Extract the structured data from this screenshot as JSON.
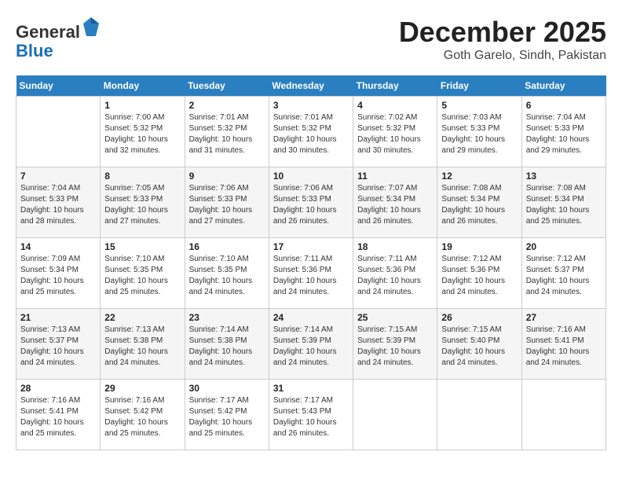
{
  "header": {
    "logo_general": "General",
    "logo_blue": "Blue",
    "month_title": "December 2025",
    "subtitle": "Goth Garelo, Sindh, Pakistan"
  },
  "calendar": {
    "weekdays": [
      "Sunday",
      "Monday",
      "Tuesday",
      "Wednesday",
      "Thursday",
      "Friday",
      "Saturday"
    ],
    "weeks": [
      [
        {
          "day": "",
          "info": ""
        },
        {
          "day": "1",
          "info": "Sunrise: 7:00 AM\nSunset: 5:32 PM\nDaylight: 10 hours\nand 32 minutes."
        },
        {
          "day": "2",
          "info": "Sunrise: 7:01 AM\nSunset: 5:32 PM\nDaylight: 10 hours\nand 31 minutes."
        },
        {
          "day": "3",
          "info": "Sunrise: 7:01 AM\nSunset: 5:32 PM\nDaylight: 10 hours\nand 30 minutes."
        },
        {
          "day": "4",
          "info": "Sunrise: 7:02 AM\nSunset: 5:32 PM\nDaylight: 10 hours\nand 30 minutes."
        },
        {
          "day": "5",
          "info": "Sunrise: 7:03 AM\nSunset: 5:33 PM\nDaylight: 10 hours\nand 29 minutes."
        },
        {
          "day": "6",
          "info": "Sunrise: 7:04 AM\nSunset: 5:33 PM\nDaylight: 10 hours\nand 29 minutes."
        }
      ],
      [
        {
          "day": "7",
          "info": "Sunrise: 7:04 AM\nSunset: 5:33 PM\nDaylight: 10 hours\nand 28 minutes."
        },
        {
          "day": "8",
          "info": "Sunrise: 7:05 AM\nSunset: 5:33 PM\nDaylight: 10 hours\nand 27 minutes."
        },
        {
          "day": "9",
          "info": "Sunrise: 7:06 AM\nSunset: 5:33 PM\nDaylight: 10 hours\nand 27 minutes."
        },
        {
          "day": "10",
          "info": "Sunrise: 7:06 AM\nSunset: 5:33 PM\nDaylight: 10 hours\nand 26 minutes."
        },
        {
          "day": "11",
          "info": "Sunrise: 7:07 AM\nSunset: 5:34 PM\nDaylight: 10 hours\nand 26 minutes."
        },
        {
          "day": "12",
          "info": "Sunrise: 7:08 AM\nSunset: 5:34 PM\nDaylight: 10 hours\nand 26 minutes."
        },
        {
          "day": "13",
          "info": "Sunrise: 7:08 AM\nSunset: 5:34 PM\nDaylight: 10 hours\nand 25 minutes."
        }
      ],
      [
        {
          "day": "14",
          "info": "Sunrise: 7:09 AM\nSunset: 5:34 PM\nDaylight: 10 hours\nand 25 minutes."
        },
        {
          "day": "15",
          "info": "Sunrise: 7:10 AM\nSunset: 5:35 PM\nDaylight: 10 hours\nand 25 minutes."
        },
        {
          "day": "16",
          "info": "Sunrise: 7:10 AM\nSunset: 5:35 PM\nDaylight: 10 hours\nand 24 minutes."
        },
        {
          "day": "17",
          "info": "Sunrise: 7:11 AM\nSunset: 5:36 PM\nDaylight: 10 hours\nand 24 minutes."
        },
        {
          "day": "18",
          "info": "Sunrise: 7:11 AM\nSunset: 5:36 PM\nDaylight: 10 hours\nand 24 minutes."
        },
        {
          "day": "19",
          "info": "Sunrise: 7:12 AM\nSunset: 5:36 PM\nDaylight: 10 hours\nand 24 minutes."
        },
        {
          "day": "20",
          "info": "Sunrise: 7:12 AM\nSunset: 5:37 PM\nDaylight: 10 hours\nand 24 minutes."
        }
      ],
      [
        {
          "day": "21",
          "info": "Sunrise: 7:13 AM\nSunset: 5:37 PM\nDaylight: 10 hours\nand 24 minutes."
        },
        {
          "day": "22",
          "info": "Sunrise: 7:13 AM\nSunset: 5:38 PM\nDaylight: 10 hours\nand 24 minutes."
        },
        {
          "day": "23",
          "info": "Sunrise: 7:14 AM\nSunset: 5:38 PM\nDaylight: 10 hours\nand 24 minutes."
        },
        {
          "day": "24",
          "info": "Sunrise: 7:14 AM\nSunset: 5:39 PM\nDaylight: 10 hours\nand 24 minutes."
        },
        {
          "day": "25",
          "info": "Sunrise: 7:15 AM\nSunset: 5:39 PM\nDaylight: 10 hours\nand 24 minutes."
        },
        {
          "day": "26",
          "info": "Sunrise: 7:15 AM\nSunset: 5:40 PM\nDaylight: 10 hours\nand 24 minutes."
        },
        {
          "day": "27",
          "info": "Sunrise: 7:16 AM\nSunset: 5:41 PM\nDaylight: 10 hours\nand 24 minutes."
        }
      ],
      [
        {
          "day": "28",
          "info": "Sunrise: 7:16 AM\nSunset: 5:41 PM\nDaylight: 10 hours\nand 25 minutes."
        },
        {
          "day": "29",
          "info": "Sunrise: 7:16 AM\nSunset: 5:42 PM\nDaylight: 10 hours\nand 25 minutes."
        },
        {
          "day": "30",
          "info": "Sunrise: 7:17 AM\nSunset: 5:42 PM\nDaylight: 10 hours\nand 25 minutes."
        },
        {
          "day": "31",
          "info": "Sunrise: 7:17 AM\nSunset: 5:43 PM\nDaylight: 10 hours\nand 26 minutes."
        },
        {
          "day": "",
          "info": ""
        },
        {
          "day": "",
          "info": ""
        },
        {
          "day": "",
          "info": ""
        }
      ]
    ]
  }
}
